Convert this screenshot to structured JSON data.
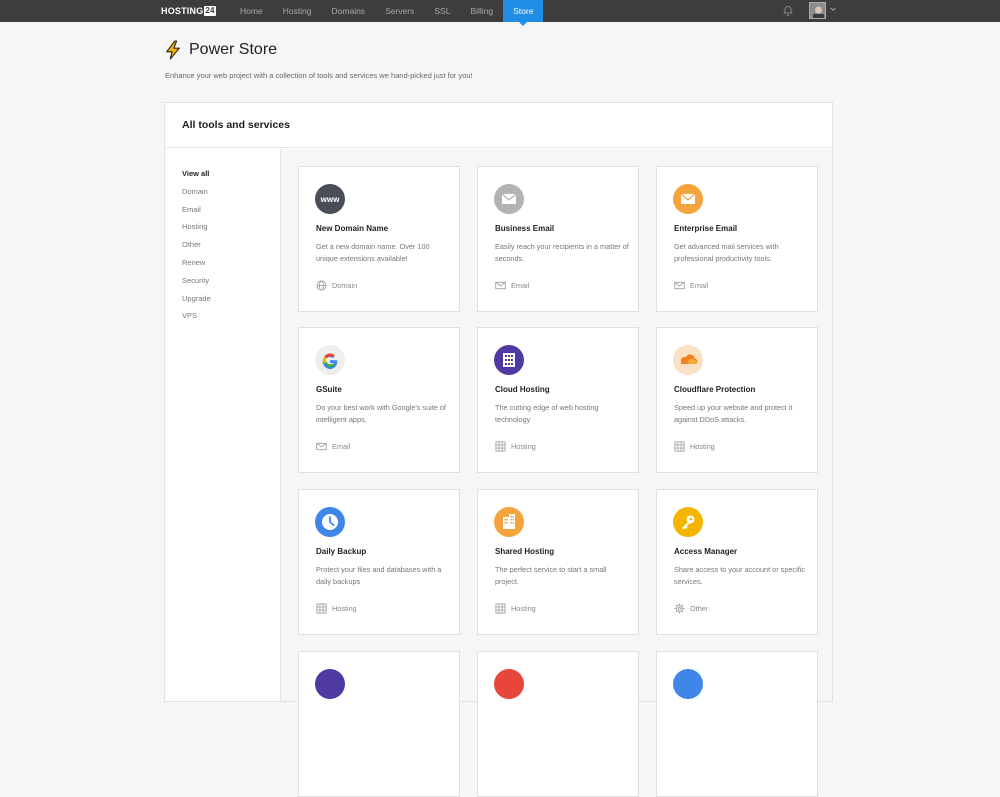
{
  "brand": {
    "name": "HOSTING",
    "suffix": "24"
  },
  "nav": {
    "items": [
      {
        "label": "Home"
      },
      {
        "label": "Hosting"
      },
      {
        "label": "Domains"
      },
      {
        "label": "Servers"
      },
      {
        "label": "SSL"
      },
      {
        "label": "Billing"
      },
      {
        "label": "Store",
        "active": true
      }
    ]
  },
  "header": {
    "title": "Power Store",
    "subtitle": "Enhance your web project with a collection of tools and services we hand-picked just for you!"
  },
  "panel": {
    "title": "All tools and services",
    "sidebar": [
      {
        "label": "View all",
        "active": true
      },
      {
        "label": "Domain"
      },
      {
        "label": "Email"
      },
      {
        "label": "Hosting"
      },
      {
        "label": "Other"
      },
      {
        "label": "Renew"
      },
      {
        "label": "Security"
      },
      {
        "label": "Upgrade"
      },
      {
        "label": "VPS"
      }
    ],
    "cards": [
      {
        "title": "New Domain Name",
        "desc": "Get a new domain name. Over 100 unique extensions available!",
        "tag": "Domain",
        "icon": "www-icon",
        "tag_icon": "globe-icon",
        "color": "#4a4f57"
      },
      {
        "title": "Business Email",
        "desc": "Easily reach your recipients in a matter of seconds.",
        "tag": "Email",
        "icon": "envelope-icon",
        "tag_icon": "envelope-icon",
        "color": "#b3b3b3"
      },
      {
        "title": "Enterprise Email",
        "desc": "Get advanced mail services with professional productivity tools.",
        "tag": "Email",
        "icon": "envelope-icon",
        "tag_icon": "envelope-icon",
        "color": "#f4a43b"
      },
      {
        "title": "GSuite",
        "desc": "Do your best work with Google's suite of intelligent apps.",
        "tag": "Email",
        "icon": "google-icon",
        "tag_icon": "envelope-icon",
        "color": "#eeeeee"
      },
      {
        "title": "Cloud Hosting",
        "desc": "The cutting edge of web hosting technology",
        "tag": "Hosting",
        "icon": "server-icon",
        "tag_icon": "building-icon",
        "color": "#4f3aa1"
      },
      {
        "title": "Cloudflare Protection",
        "desc": "Speed up your website and protect it against DDoS attacks.",
        "tag": "Hosting",
        "icon": "cloud-icon",
        "tag_icon": "building-icon",
        "color": "#fbe0c3"
      },
      {
        "title": "Daily Backup",
        "desc": "Protect your files and databases with a daily backups",
        "tag": "Hosting",
        "icon": "clock-icon",
        "tag_icon": "building-icon",
        "color": "#3f86e8"
      },
      {
        "title": "Shared Hosting",
        "desc": "The perfect service to start a small project.",
        "tag": "Hosting",
        "icon": "buildings-icon",
        "tag_icon": "building-icon",
        "color": "#f4a43b"
      },
      {
        "title": "Access Manager",
        "desc": "Share access to your account or specific services.",
        "tag": "Other",
        "icon": "key-icon",
        "tag_icon": "gear-icon",
        "color": "#f4b400"
      },
      {
        "title": "",
        "desc": "",
        "tag": "",
        "icon": "partial-icon",
        "tag_icon": "",
        "color": "#4f3aa1"
      },
      {
        "title": "",
        "desc": "",
        "tag": "",
        "icon": "partial-icon",
        "tag_icon": "",
        "color": "#e8453c"
      },
      {
        "title": "",
        "desc": "",
        "tag": "",
        "icon": "partial-icon",
        "tag_icon": "",
        "color": "#3f86e8"
      }
    ]
  }
}
